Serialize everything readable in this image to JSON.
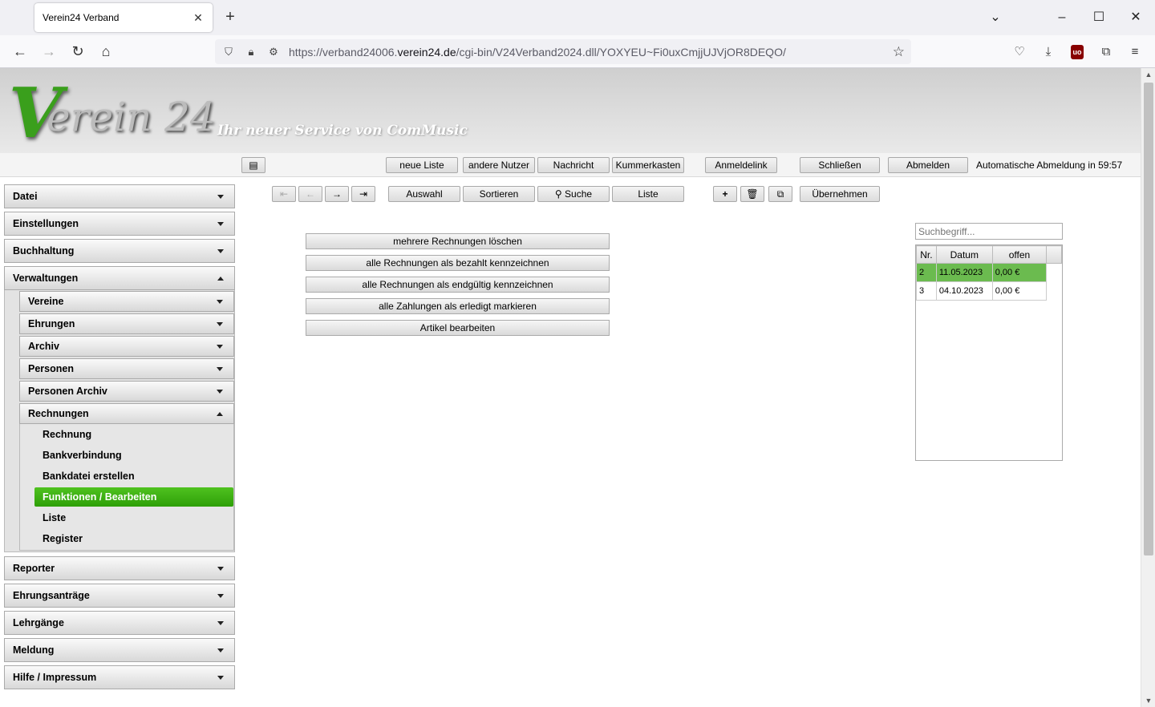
{
  "browser": {
    "tab_title": "Verein24 Verband",
    "url_prefix": "https://verband24006.",
    "url_domain": "verein24.de",
    "url_path": "/cgi-bin/V24Verband2024.dll/YOXYEU~Fi0uxCmjjUJVjOR8DEQO/"
  },
  "header": {
    "logo_v": "V",
    "logo_rest": "erein 24",
    "slogan": "Ihr neuer Service von ComMusic"
  },
  "topbar": {
    "neue_liste": "neue Liste",
    "andere_nutzer": "andere Nutzer",
    "nachricht": "Nachricht",
    "kummerkasten": "Kummerkasten",
    "anmeldelink": "Anmeldelink",
    "schliessen": "Schließen",
    "abmelden": "Abmelden",
    "auto_logout": "Automatische Abmeldung in 59:57"
  },
  "sidebar": {
    "datei": "Datei",
    "einstellungen": "Einstellungen",
    "buchhaltung": "Buchhaltung",
    "verwaltungen": "Verwaltungen",
    "vereine": "Vereine",
    "ehrungen": "Ehrungen",
    "archiv": "Archiv",
    "personen": "Personen",
    "personen_archiv": "Personen Archiv",
    "rechnungen": "Rechnungen",
    "rechnung": "Rechnung",
    "bankverbindung": "Bankverbindung",
    "bankdatei": "Bankdatei erstellen",
    "funktionen": "Funktionen / Bearbeiten",
    "liste": "Liste",
    "register": "Register",
    "reporter": "Reporter",
    "ehrungsantraege": "Ehrungsanträge",
    "lehrgaenge": "Lehrgänge",
    "meldung": "Meldung",
    "hilfe": "Hilfe / Impressum"
  },
  "toolbar": {
    "auswahl": "Auswahl",
    "sortieren": "Sortieren",
    "suche": "Suche",
    "liste": "Liste",
    "uebernehmen": "Übernehmen"
  },
  "actions": {
    "a1": "mehrere Rechnungen löschen",
    "a2": "alle Rechnungen als bezahlt kennzeichnen",
    "a3": "alle Rechnungen als endgültig kennzeichnen",
    "a4": "alle Zahlungen als erledigt markieren",
    "a5": "Artikel bearbeiten"
  },
  "search": {
    "placeholder": "Suchbegriff..."
  },
  "grid": {
    "headers": {
      "nr": "Nr.",
      "datum": "Datum",
      "offen": "offen"
    },
    "rows": [
      {
        "nr": "2",
        "datum": "11.05.2023",
        "offen": "0,00 €"
      },
      {
        "nr": "3",
        "datum": "04.10.2023",
        "offen": "0,00 €"
      }
    ]
  },
  "colors": {
    "accent_green": "#3aa811",
    "selected_row": "#6bbb4f"
  }
}
